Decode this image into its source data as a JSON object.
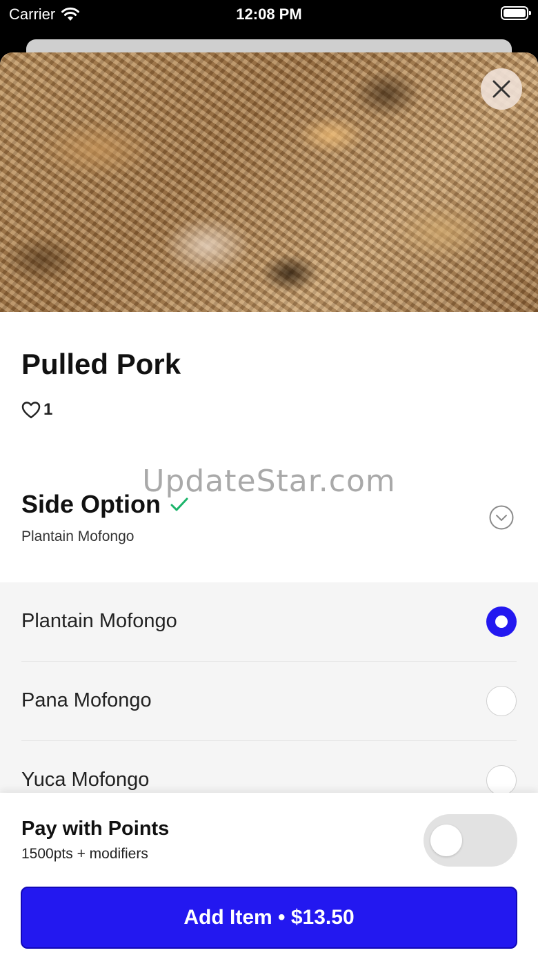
{
  "status_bar": {
    "carrier": "Carrier",
    "time": "12:08 PM"
  },
  "item": {
    "title": "Pulled Pork",
    "likes": "1"
  },
  "watermark": "UpdateStar.com",
  "side_option": {
    "title": "Side Option",
    "selected": "Plantain Mofongo",
    "options": [
      {
        "label": "Plantain Mofongo",
        "selected": true
      },
      {
        "label": "Pana Mofongo",
        "selected": false
      },
      {
        "label": "Yuca Mofongo",
        "selected": false
      }
    ]
  },
  "pay_with_points": {
    "title": "Pay with Points",
    "subtitle": "1500pts + modifiers",
    "enabled": false
  },
  "add_button": {
    "label": "Add Item • $13.50"
  },
  "colors": {
    "accent": "#2318f0",
    "check": "#1bb46a"
  }
}
